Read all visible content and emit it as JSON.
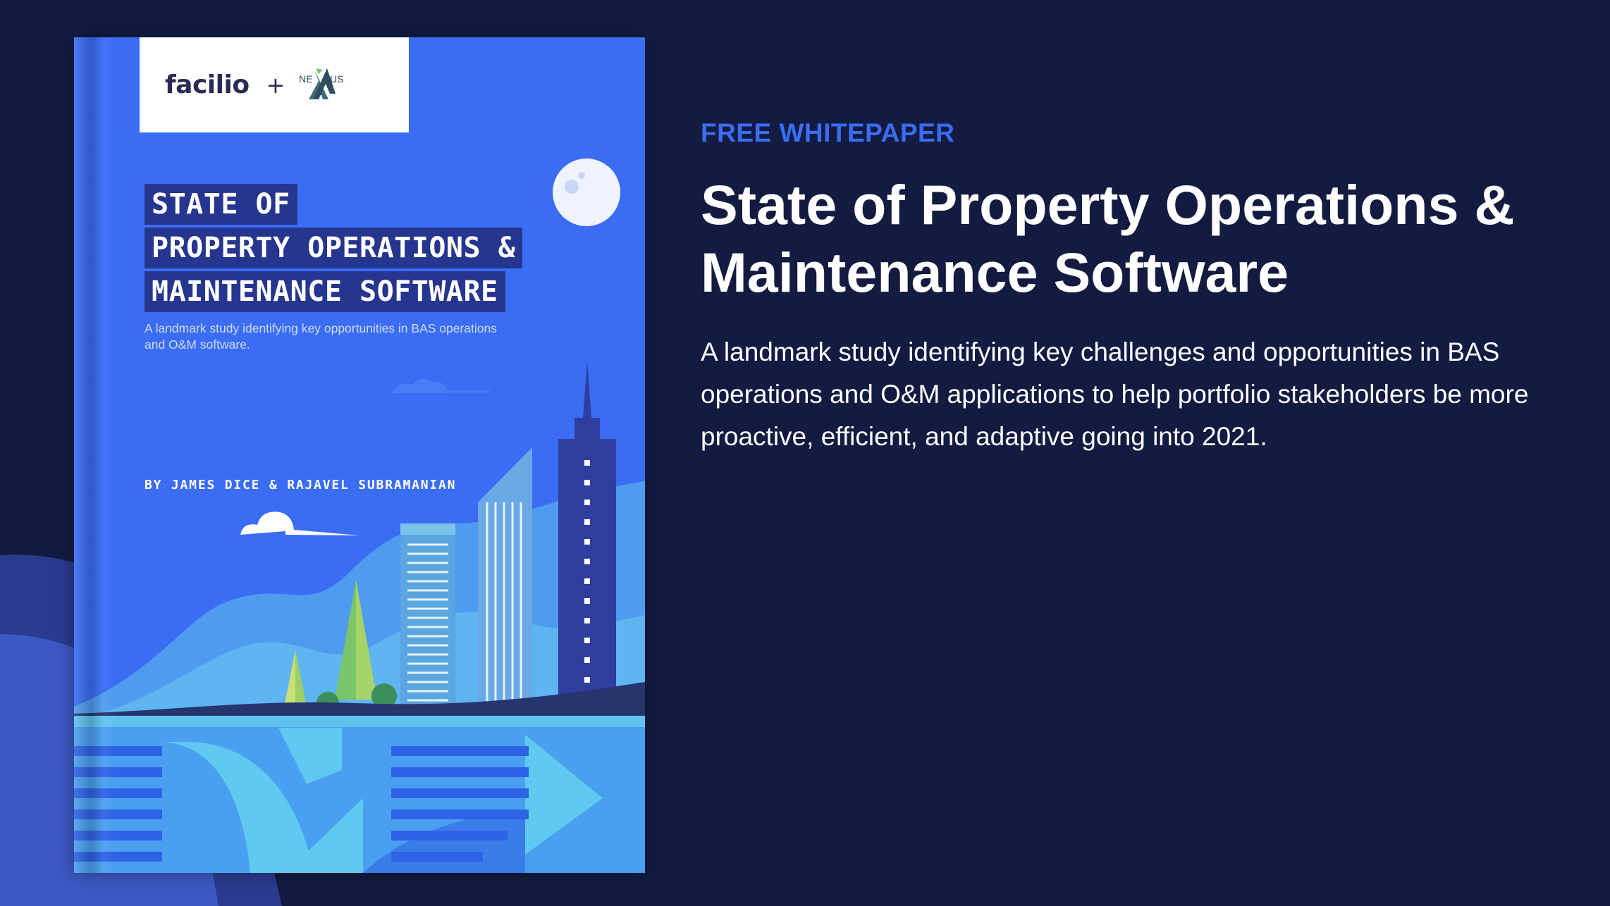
{
  "cover": {
    "logo_primary": "facilio",
    "logo_separator": "+",
    "logo_secondary": "NEXUS",
    "title_lines": [
      "STATE OF",
      "PROPERTY OPERATIONS &",
      "MAINTENANCE SOFTWARE"
    ],
    "subtitle": "A landmark study identifying key opportunities in BAS operations and O&M software.",
    "authors": "BY JAMES DICE & RAJAVEL SUBRAMANIAN"
  },
  "hero": {
    "tag": "FREE WHITEPAPER",
    "title": "State of Property Operations & Maintenance Software",
    "description": "A landmark study identifying key challenges and opportunities in BAS operations and O&M applications to help portfolio stakeholders be more proactive, efficient, and adaptive going into 2021."
  },
  "colors": {
    "background": "#131b41",
    "accent": "#3a6cf4",
    "cover_blue": "#3a6cf4",
    "title_block": "#26358e"
  }
}
